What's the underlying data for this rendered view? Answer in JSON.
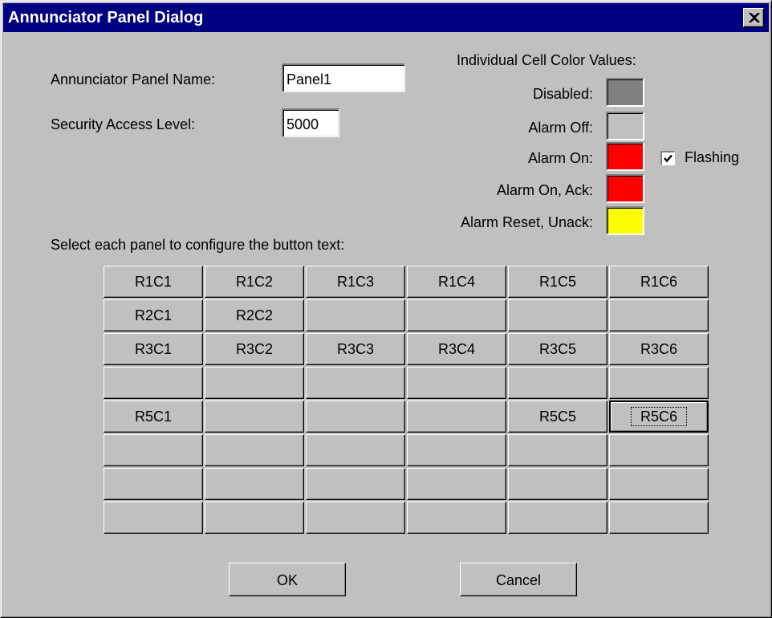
{
  "window": {
    "title": "Annunciator Panel Dialog"
  },
  "form": {
    "panel_name_label": "Annunciator Panel Name:",
    "panel_name_value": "Panel1",
    "security_label": "Security Access Level:",
    "security_value": "5000"
  },
  "colors": {
    "heading": "Individual Cell Color Values:",
    "items": [
      {
        "label": "Disabled:",
        "color": "#808080"
      },
      {
        "label": "Alarm Off:",
        "color": "#c0c0c0"
      },
      {
        "label": "Alarm On:",
        "color": "#ff0000"
      },
      {
        "label": "Alarm On, Ack:",
        "color": "#ff0000"
      },
      {
        "label": "Alarm Reset, Unack:",
        "color": "#ffff00"
      }
    ],
    "flashing_label": "Flashing",
    "flashing_checked": true
  },
  "grid": {
    "instruction": "Select each panel to configure the button text:",
    "rows": [
      [
        "R1C1",
        "R1C2",
        "R1C3",
        "R1C4",
        "R1C5",
        "R1C6"
      ],
      [
        "R2C1",
        "R2C2",
        "",
        "",
        "",
        ""
      ],
      [
        "R3C1",
        "R3C2",
        "R3C3",
        "R3C4",
        "R3C5",
        "R3C6"
      ],
      [
        "",
        "",
        "",
        "",
        "",
        ""
      ],
      [
        "R5C1",
        "",
        "",
        "",
        "R5C5",
        "R5C6"
      ],
      [
        "",
        "",
        "",
        "",
        "",
        ""
      ],
      [
        "",
        "",
        "",
        "",
        "",
        ""
      ],
      [
        "",
        "",
        "",
        "",
        "",
        ""
      ]
    ],
    "focused_cell": "R5C6"
  },
  "buttons": {
    "ok": "OK",
    "cancel": "Cancel"
  }
}
